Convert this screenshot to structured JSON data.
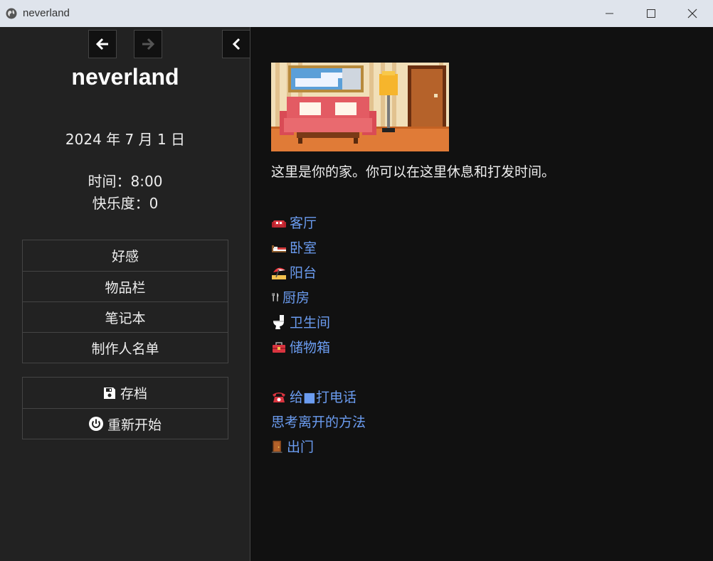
{
  "window": {
    "title": "neverland",
    "icon": "globe-icon"
  },
  "sidebar": {
    "story_title": "neverland",
    "date": "2024 年 7 月 1 日",
    "time_label": "时间：8:00",
    "happiness_label": "快乐度：0",
    "menu": [
      {
        "label": "好感"
      },
      {
        "label": "物品栏"
      },
      {
        "label": "笔记本"
      },
      {
        "label": "制作人名单"
      }
    ],
    "save_label": "存档",
    "restart_label": "重新开始"
  },
  "passage": {
    "intro": "这里是你的家。你可以在这里休息和打发时间。",
    "rooms": [
      {
        "label": "客厅",
        "icon": "sofa-icon"
      },
      {
        "label": "卧室",
        "icon": "bed-icon"
      },
      {
        "label": "阳台",
        "icon": "beach-umbrella-icon"
      },
      {
        "label": "厨房",
        "icon": "fork-knife-icon"
      },
      {
        "label": "卫生间",
        "icon": "toilet-icon"
      },
      {
        "label": "储物箱",
        "icon": "toolbox-icon"
      }
    ],
    "actions": [
      {
        "label": "给■打电话",
        "icon": "telephone-icon"
      },
      {
        "label": "思考离开的方法",
        "icon": ""
      },
      {
        "label": "出门",
        "icon": "door-icon"
      }
    ]
  },
  "colors": {
    "link": "#6b9cf0",
    "sidebar_bg": "#222222",
    "main_bg": "#111111"
  }
}
